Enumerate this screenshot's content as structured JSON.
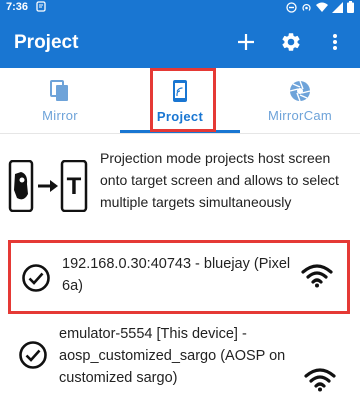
{
  "status_bar": {
    "time": "7:36"
  },
  "app_bar": {
    "title": "Project"
  },
  "tabs": [
    {
      "label": "Mirror",
      "icon": "copy-icon"
    },
    {
      "label": "Project",
      "icon": "phone-cast-icon"
    },
    {
      "label": "MirrorCam",
      "icon": "camera-aperture-icon"
    }
  ],
  "active_tab": "Project",
  "description": "Projection mode projects host screen onto target screen and allows to select multiple targets simultaneously",
  "illustration_letter": "T",
  "devices": [
    {
      "name": "192.168.0.30:40743 - bluejay (Pixel 6a)",
      "selected": true
    },
    {
      "name": "emulator-5554 [This device] - aosp_customized_sargo (AOSP on customized sargo)",
      "selected": true
    }
  ],
  "colors": {
    "primary": "#1976d2",
    "highlight": "#e53935",
    "tab_inactive": "#6ea3d9"
  }
}
